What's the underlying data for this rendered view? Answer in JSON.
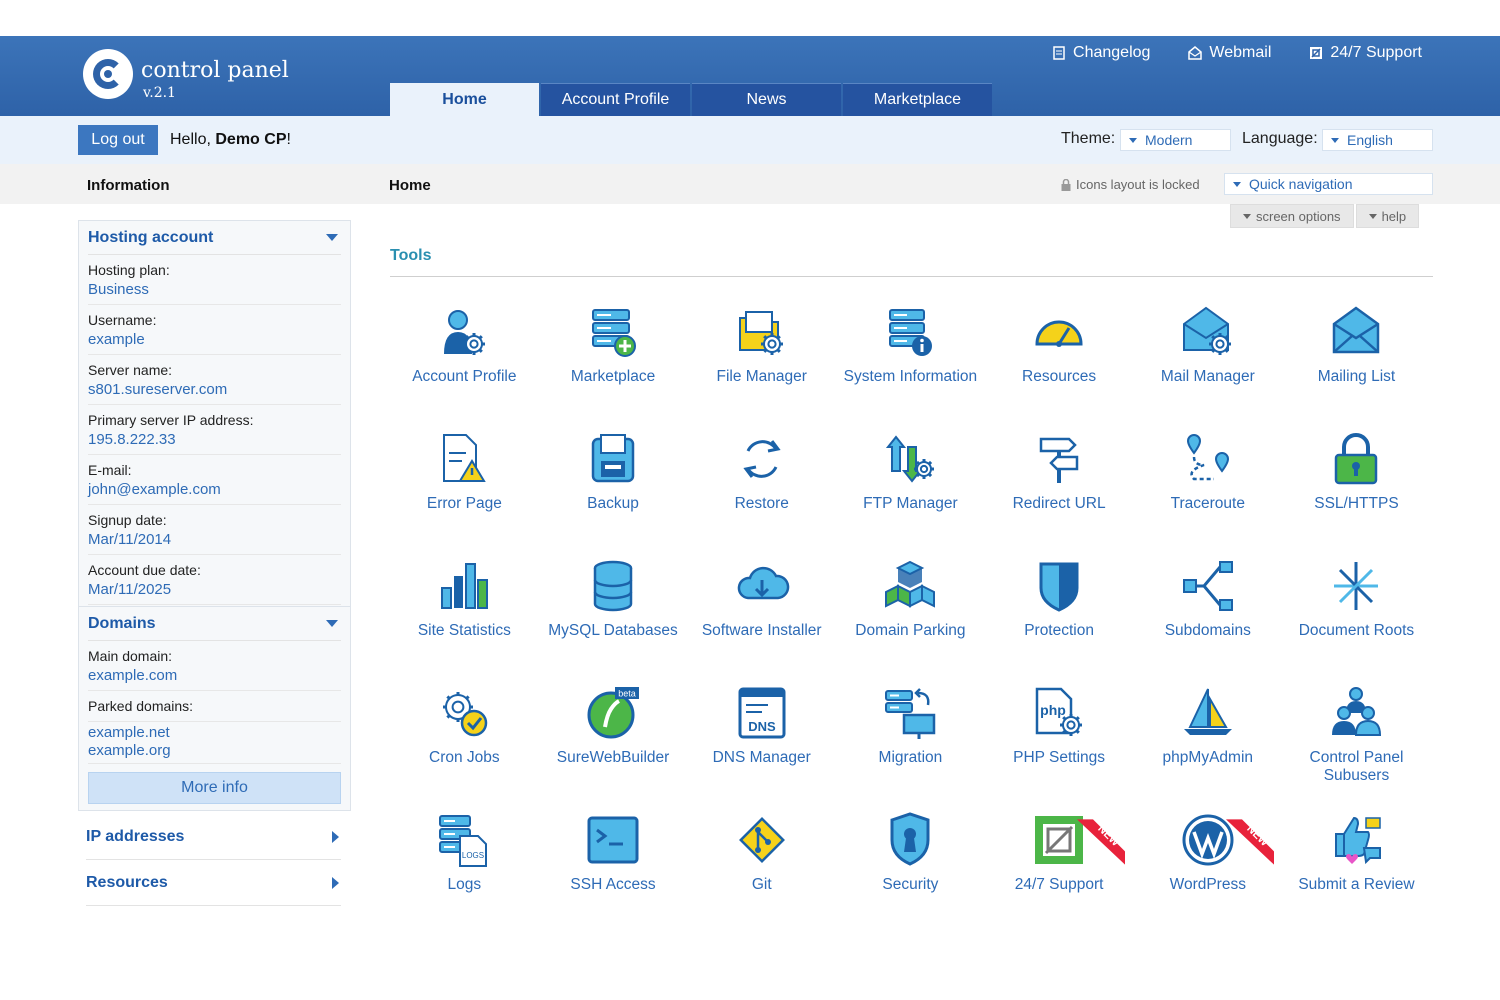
{
  "app": {
    "title": "control panel",
    "version": "v.2.1"
  },
  "toplinks": [
    {
      "label": "Changelog",
      "icon": "changelog-icon"
    },
    {
      "label": "Webmail",
      "icon": "webmail-icon"
    },
    {
      "label": "24/7 Support",
      "icon": "support-icon"
    }
  ],
  "tabs": [
    {
      "label": "Home"
    },
    {
      "label": "Account Profile"
    },
    {
      "label": "News"
    },
    {
      "label": "Marketplace"
    }
  ],
  "subbar": {
    "logout": "Log out",
    "hello_prefix": "Hello, ",
    "user": "Demo CP",
    "hello_suffix": "!",
    "theme_label": "Theme:",
    "theme_value": "Modern",
    "language_label": "Language:",
    "language_value": "English"
  },
  "titlebar": {
    "information": "Information",
    "home": "Home",
    "locked": "Icons layout is locked",
    "quick_nav": "Quick navigation",
    "screen_options": "screen options",
    "help": "help"
  },
  "hosting": {
    "title": "Hosting account",
    "fields": [
      {
        "label": "Hosting plan:",
        "value": "Business"
      },
      {
        "label": "Username:",
        "value": "example"
      },
      {
        "label": "Server name:",
        "value": "s801.sureserver.com"
      },
      {
        "label": "Primary server IP address:",
        "value": "195.8.222.33"
      },
      {
        "label": "E-mail:",
        "value": "john@example.com"
      },
      {
        "label": "Signup date:",
        "value": "Mar/11/2014"
      },
      {
        "label": "Account due date:",
        "value": "Mar/11/2025"
      }
    ]
  },
  "domains": {
    "title": "Domains",
    "main_label": "Main domain:",
    "main_value": "example.com",
    "parked_label": "Parked domains:",
    "parked_values": [
      "example.net",
      "example.org"
    ],
    "more_info": "More info"
  },
  "collapsed": [
    {
      "label": "IP addresses"
    },
    {
      "label": "Resources"
    }
  ],
  "tools": {
    "title": "Tools",
    "new_badge": "NEW",
    "items": [
      {
        "label": "Account Profile",
        "icon": "account-profile-icon"
      },
      {
        "label": "Marketplace",
        "icon": "marketplace-icon"
      },
      {
        "label": "File Manager",
        "icon": "file-manager-icon"
      },
      {
        "label": "System Information",
        "icon": "system-information-icon"
      },
      {
        "label": "Resources",
        "icon": "resources-icon"
      },
      {
        "label": "Mail Manager",
        "icon": "mail-manager-icon"
      },
      {
        "label": "Mailing List",
        "icon": "mailing-list-icon"
      },
      {
        "label": "Error Page",
        "icon": "error-page-icon"
      },
      {
        "label": "Backup",
        "icon": "backup-icon"
      },
      {
        "label": "Restore",
        "icon": "restore-icon"
      },
      {
        "label": "FTP Manager",
        "icon": "ftp-manager-icon"
      },
      {
        "label": "Redirect URL",
        "icon": "redirect-url-icon"
      },
      {
        "label": "Traceroute",
        "icon": "traceroute-icon"
      },
      {
        "label": "SSL/HTTPS",
        "icon": "ssl-https-icon"
      },
      {
        "label": "Site Statistics",
        "icon": "site-statistics-icon"
      },
      {
        "label": "MySQL Databases",
        "icon": "mysql-databases-icon"
      },
      {
        "label": "Software Installer",
        "icon": "software-installer-icon"
      },
      {
        "label": "Domain Parking",
        "icon": "domain-parking-icon"
      },
      {
        "label": "Protection",
        "icon": "protection-icon"
      },
      {
        "label": "Subdomains",
        "icon": "subdomains-icon"
      },
      {
        "label": "Document Roots",
        "icon": "document-roots-icon"
      },
      {
        "label": "Cron Jobs",
        "icon": "cron-jobs-icon"
      },
      {
        "label": "SureWebBuilder",
        "icon": "surewebbuilder-icon"
      },
      {
        "label": "DNS Manager",
        "icon": "dns-manager-icon"
      },
      {
        "label": "Migration",
        "icon": "migration-icon"
      },
      {
        "label": "PHP Settings",
        "icon": "php-settings-icon"
      },
      {
        "label": "phpMyAdmin",
        "icon": "phpmyadmin-icon"
      },
      {
        "label": "Control Panel Subusers",
        "icon": "subusers-icon"
      },
      {
        "label": "Logs",
        "icon": "logs-icon"
      },
      {
        "label": "SSH Access",
        "icon": "ssh-access-icon"
      },
      {
        "label": "Git",
        "icon": "git-icon"
      },
      {
        "label": "Security",
        "icon": "security-icon"
      },
      {
        "label": "24/7 Support",
        "icon": "support-tool-icon"
      },
      {
        "label": "WordPress",
        "icon": "wordpress-icon"
      },
      {
        "label": "Submit a Review",
        "icon": "submit-review-icon"
      }
    ]
  },
  "icon_text": {
    "beta": "beta",
    "dns": "DNS",
    "php": "php",
    "logs": "LOGS"
  },
  "colors": {
    "brand": "#2e62a8",
    "accent": "#2e6bb6",
    "tools_title": "#2a8fb0",
    "new_badge": "#e8223b"
  }
}
